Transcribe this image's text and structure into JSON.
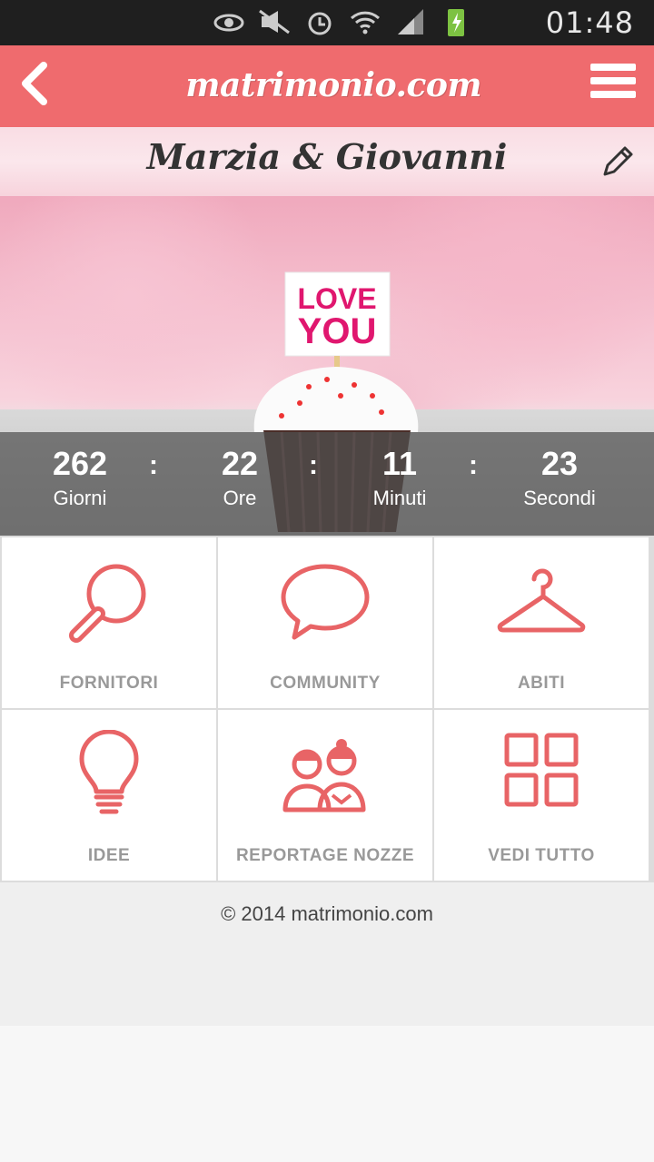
{
  "status_bar": {
    "time": "01:48",
    "icons": [
      "eye-icon",
      "mute-icon",
      "alarm-icon",
      "wifi-icon",
      "signal-icon",
      "battery-icon"
    ]
  },
  "header": {
    "logo_text": "matrimonio.com",
    "back_icon": "chevron-left-icon",
    "menu_icon": "hamburger-icon"
  },
  "couple": {
    "name": "Marzia & Giovanni"
  },
  "hero": {
    "sign_line1": "LOVE",
    "sign_line2": "YOU"
  },
  "countdown": {
    "days": {
      "value": "262",
      "label": "Giorni"
    },
    "hours": {
      "value": "22",
      "label": "Ore"
    },
    "minutes": {
      "value": "11",
      "label": "Minuti"
    },
    "seconds": {
      "value": "23",
      "label": "Secondi"
    },
    "separator": ":"
  },
  "tiles": [
    {
      "label": "FORNITORI",
      "icon": "magnifier-icon"
    },
    {
      "label": "COMMUNITY",
      "icon": "speech-bubble-icon"
    },
    {
      "label": "ABITI",
      "icon": "hanger-icon"
    },
    {
      "label": "IDEE",
      "icon": "lightbulb-icon"
    },
    {
      "label": "REPORTAGE NOZZE",
      "icon": "couple-icon"
    },
    {
      "label": "VEDI TUTTO",
      "icon": "grid-icon"
    }
  ],
  "footer": {
    "copyright": "© 2014 matrimonio.com"
  },
  "colors": {
    "brand": "#ef6b6e",
    "icon": "#e86466",
    "tile_label": "#999999"
  }
}
